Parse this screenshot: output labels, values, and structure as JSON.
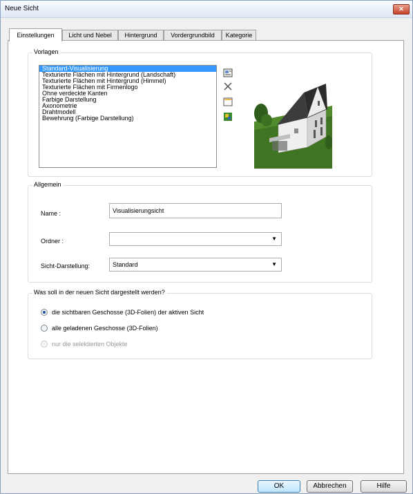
{
  "window": {
    "title": "Neue Sicht",
    "close_glyph": "✕"
  },
  "tabs": [
    {
      "label": "Einstellungen",
      "active": true
    },
    {
      "label": "Licht und Nebel",
      "active": false
    },
    {
      "label": "Hintergrund",
      "active": false
    },
    {
      "label": "Vordergrundbild",
      "active": false
    },
    {
      "label": "Kategorie",
      "active": false
    }
  ],
  "templates": {
    "group_label": "Vorlagen",
    "items": [
      "Standard-Visualisierung",
      "Texturierte Flächen mit Hintergrund (Landschaft)",
      "Texturierte Flächen mit Hintergrund (Himmel)",
      "Texturierte Flächen mit Firmenlogo",
      "Ohne verdeckte Kanten",
      "Farbige Darstellung",
      "Axonometrie",
      "Drahtmodell",
      "Bewehrung (Farbige Darstellung)"
    ],
    "selected_index": 0,
    "tool_icons": [
      "new-template-icon",
      "delete-icon",
      "edit-icon",
      "color-settings-icon"
    ]
  },
  "general": {
    "group_label": "Allgemein",
    "name_label": "Name :",
    "name_value": "Visualisierungsicht",
    "folder_label": "Ordner :",
    "folder_value": "",
    "display_label": "Sicht-Darstellung:",
    "display_value": "Standard"
  },
  "show": {
    "group_label": "Was soll in der neuen Sicht dargestellt werden?",
    "options": [
      {
        "label": "die sichtbaren Geschosse (3D-Folien) der aktiven Sicht",
        "checked": true,
        "disabled": false
      },
      {
        "label": "alle geladenen Geschosse (3D-Folien)",
        "checked": false,
        "disabled": false
      },
      {
        "label": "nur die selektierten Objekte",
        "checked": false,
        "disabled": true
      }
    ]
  },
  "buttons": {
    "ok": "OK",
    "cancel": "Abbrechen",
    "help": "Hilfe"
  },
  "colors": {
    "selection": "#3399ff",
    "titlebar": "#dfe9f5",
    "close": "#c5442c"
  }
}
